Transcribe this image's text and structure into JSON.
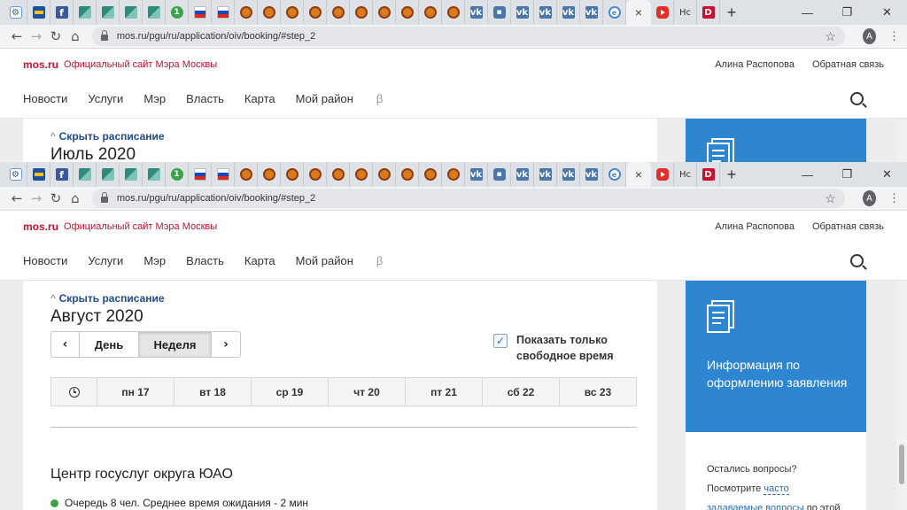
{
  "browser": {
    "tab_favicons": [
      "gear-icon",
      "card-icon",
      "facebook-icon",
      "teal-icon",
      "teal-icon",
      "teal-icon",
      "teal-icon",
      "green-circle-icon",
      "russia-flag-icon",
      "russia-flag-icon",
      "emblem-icon",
      "emblem-icon",
      "emblem-icon",
      "emblem-icon",
      "emblem-icon",
      "emblem-icon",
      "emblem-icon",
      "emblem-icon",
      "emblem-icon",
      "emblem-icon",
      "vk-icon",
      "chat-icon",
      "vk-icon",
      "vk-icon",
      "vk-icon",
      "vk-icon",
      "globe-icon"
    ],
    "vk_text": "vk",
    "fb_text": "f",
    "green_text": "1",
    "active_tab_close": "×",
    "extra_tab_text": "Нс",
    "extra_tab2_text": "D",
    "new_tab": "+",
    "win_min": "—",
    "win_max": "❐",
    "win_close": "✕",
    "back": "←",
    "forward": "→",
    "reload": "↻",
    "home": "⌂",
    "url": "mos.ru/pgu/ru/application/oiv/booking/#step_2",
    "star": "☆",
    "account": "A",
    "menu": "⋮"
  },
  "site": {
    "logo": "mos.ru",
    "logo_sub": "Официальный сайт Мэра Москвы",
    "user_name": "Алина Распопова",
    "feedback": "Обратная связь",
    "nav": [
      "Новости",
      "Услуги",
      "Мэр",
      "Власть",
      "Карта",
      "Мой район"
    ],
    "beta": "β"
  },
  "schedule_top": {
    "toggle": "Скрыть расписание",
    "month": "Июль 2020"
  },
  "schedule": {
    "toggle": "Скрыть расписание",
    "chevron": "^",
    "month": "Август 2020",
    "prev": "‹",
    "next": "›",
    "day": "День",
    "week": "Неделя",
    "check_mark": "✓",
    "free_only": "Показать только свободное время",
    "days": [
      "пн 17",
      "вт 18",
      "ср 19",
      "чт 20",
      "пт 21",
      "сб 22",
      "вс 23"
    ],
    "center": "Центр госуслуг округа ЮАО",
    "queue": "Очередь 8 чел. Среднее время ожидания - 2 мин"
  },
  "sidebar": {
    "info_title": "Информация по оформлению заявления",
    "q_line1": "Остались вопросы?",
    "q_see": "Посмотрите",
    "q_link1": "часто",
    "q_link2": "задаваемые вопросы",
    "q_tail": "по этой"
  },
  "colors": {
    "brand_red": "#c8102e",
    "info_blue": "#2e86d1",
    "link_blue": "#1f4b8f"
  }
}
